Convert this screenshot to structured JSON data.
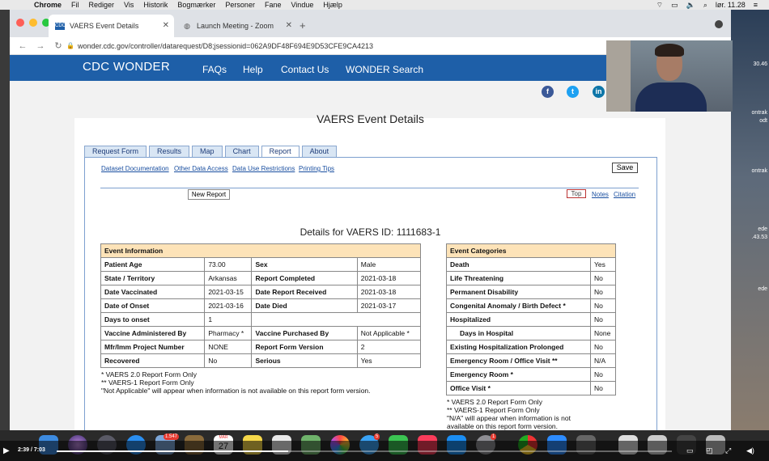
{
  "menubar": {
    "app": "Chrome",
    "items": [
      "Fil",
      "Rediger",
      "Vis",
      "Historik",
      "Bogmærker",
      "Personer",
      "Fane",
      "Vindue",
      "Hjælp"
    ],
    "clock": "lør. 11.28"
  },
  "browser": {
    "tabs": [
      {
        "label": "VAERS Event Details",
        "icon": "cdc-favicon"
      },
      {
        "label": "Launch Meeting - Zoom",
        "icon": "globe-icon"
      }
    ],
    "url": "wonder.cdc.gov/controller/datarequest/D8;jsessionid=062A9DF48F694E9D53CFE9CA4213"
  },
  "site": {
    "brand": "CDC WONDER",
    "nav": [
      "FAQs",
      "Help",
      "Contact Us",
      "WONDER Search"
    ],
    "social": [
      "facebook-icon",
      "twitter-icon",
      "linkedin-icon"
    ]
  },
  "page": {
    "title": "VAERS Event Details",
    "tabs": [
      "Request Form",
      "Results",
      "Map",
      "Chart",
      "Report",
      "About"
    ],
    "active_tab": "Report",
    "links": [
      "Dataset Documentation",
      "Other Data Access",
      "Data Use Restrictions",
      "Printing Tips"
    ],
    "save_label": "Save",
    "new_report_label": "New Report",
    "top_label": "Top",
    "notes_label": "Notes",
    "citation_label": "Citation",
    "details_heading": "Details for VAERS ID: 1111683-1"
  },
  "event_info": {
    "header": "Event Information",
    "rows": [
      [
        "Patient Age",
        "73.00",
        "Sex",
        "Male"
      ],
      [
        "State / Territory",
        "Arkansas",
        "Report Completed",
        "2021-03-18"
      ],
      [
        "Date Vaccinated",
        "2021-03-15",
        "Date Report Received",
        "2021-03-18"
      ],
      [
        "Date of Onset",
        "2021-03-16",
        "Date Died",
        "2021-03-17"
      ],
      [
        "Days to onset",
        "1",
        "",
        ""
      ],
      [
        "Vaccine Administered By",
        "Pharmacy *",
        "Vaccine Purchased By",
        "Not Applicable *"
      ],
      [
        "Mfr/Imm Project Number",
        "NONE",
        "Report Form Version",
        "2"
      ],
      [
        "Recovered",
        "No",
        "Serious",
        "Yes"
      ]
    ],
    "footnotes": [
      "* VAERS 2.0 Report Form Only",
      "** VAERS-1 Report Form Only",
      "\"Not Applicable\" will appear when information is not available on this report form version."
    ]
  },
  "event_categories": {
    "header": "Event Categories",
    "rows": [
      [
        "Death",
        "Yes"
      ],
      [
        "Life Threatening",
        "No"
      ],
      [
        "Permanent Disability",
        "No"
      ],
      [
        "Congenital Anomaly / Birth Defect *",
        "No"
      ],
      [
        "Hospitalized",
        "No"
      ],
      [
        "Days in Hospital",
        "None"
      ],
      [
        "Existing Hospitalization Prolonged",
        "No"
      ],
      [
        "Emergency Room / Office Visit **",
        "N/A"
      ],
      [
        "Emergency Room *",
        "No"
      ],
      [
        "Office Visit *",
        "No"
      ]
    ],
    "footnotes": [
      "* VAERS 2.0 Report Form Only",
      "** VAERS-1 Report Form Only",
      "\"N/A\" will appear when information is not",
      "available on this report form version."
    ]
  },
  "desktop_labels": [
    "30.46",
    "ontrak",
    "odt",
    "ontrak",
    "ede",
    ".43.53",
    "ede"
  ],
  "dock": {
    "badges": [
      "1.547",
      "MAR",
      "27",
      "5",
      "1"
    ]
  },
  "player": {
    "time": "2:39 / 7:03",
    "progress": 0.376
  },
  "colors": {
    "cdc_blue": "#1e5fa8",
    "table_header": "#fde3b8"
  }
}
